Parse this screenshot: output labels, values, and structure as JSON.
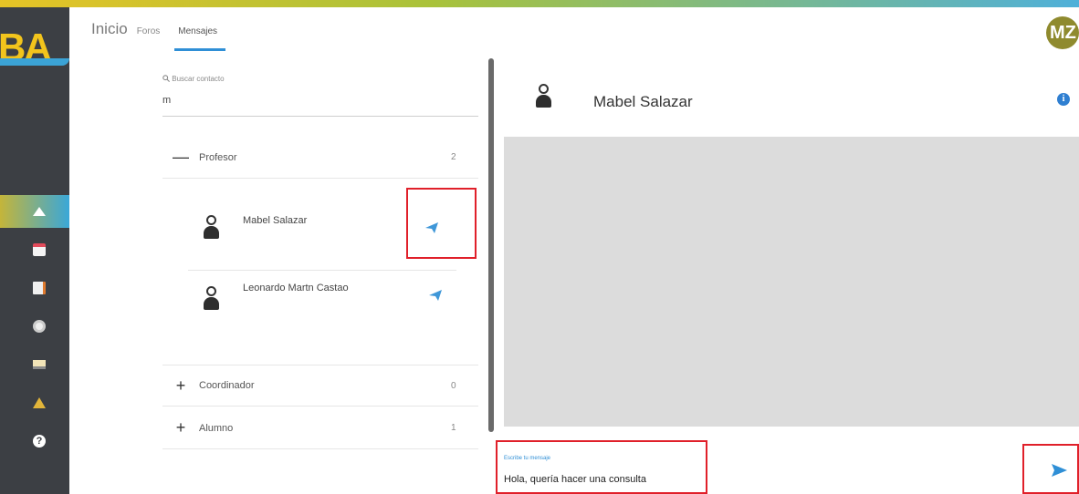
{
  "header": {
    "logo_text": "BA",
    "tabs": [
      {
        "label": "Inicio"
      },
      {
        "label": "Foros"
      },
      {
        "label": "Mensajes",
        "active": true
      }
    ],
    "user_initials": "MZ"
  },
  "sidebar": {
    "items": [
      {
        "icon": "home-icon",
        "active": true
      },
      {
        "icon": "calendar-icon"
      },
      {
        "icon": "notes-icon"
      },
      {
        "icon": "disk-icon"
      },
      {
        "icon": "computer-icon"
      },
      {
        "icon": "person-icon"
      },
      {
        "icon": "help-icon",
        "glyph": "?"
      }
    ]
  },
  "contacts": {
    "search_placeholder": "Buscar contacto",
    "search_value": "m",
    "groups": [
      {
        "toggle": "—",
        "name": "Profesor",
        "count": "2",
        "expanded": true
      },
      {
        "toggle": "+",
        "name": "Coordinador",
        "count": "0"
      },
      {
        "toggle": "+",
        "name": "Alumno",
        "count": "1"
      }
    ],
    "people": [
      {
        "name": "Mabel Salazar"
      },
      {
        "name": "Leonardo Martn Castao"
      }
    ]
  },
  "chat": {
    "contact_name": "Mabel Salazar",
    "info_glyph": "i",
    "compose_label": "Escribe tu mensaje",
    "compose_value": "Hola, quería hacer una consulta"
  },
  "colors": {
    "accent": "#2f8fd6",
    "sidebar": "#3c3f44",
    "highlight": "#e0202a",
    "chat_bg": "#dcdcdc"
  }
}
